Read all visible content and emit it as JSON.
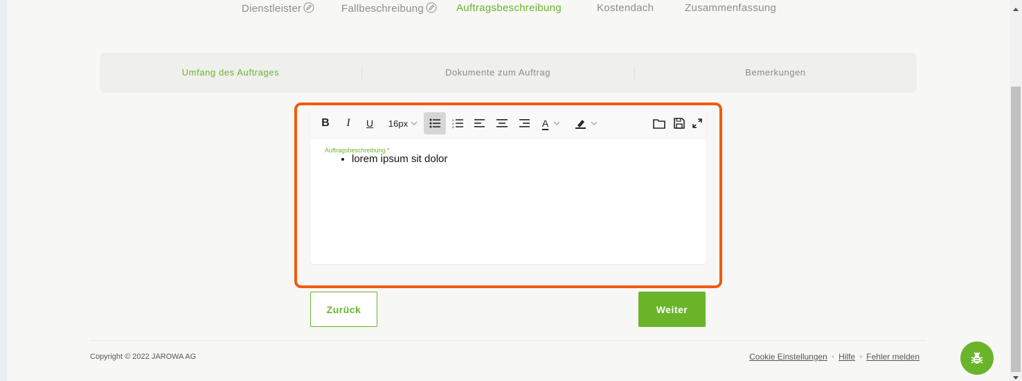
{
  "steps": [
    {
      "label": "Dienstleister",
      "active": false,
      "edit_icon": "pencil-circle-icon"
    },
    {
      "label": "Fallbeschreibung",
      "active": false,
      "edit_icon": "pencil-circle-icon"
    },
    {
      "label": "Auftragsbeschreibung",
      "active": true
    },
    {
      "label": "Kostendach",
      "active": false
    },
    {
      "label": "Zusammenfassung",
      "active": false
    }
  ],
  "tabs": [
    {
      "label": "Umfang des Auftrages",
      "active": true
    },
    {
      "label": "Dokumente zum Auftrag",
      "active": false
    },
    {
      "label": "Bemerkungen",
      "active": false
    }
  ],
  "toolbar": {
    "bold": "B",
    "italic": "I",
    "underline": "U",
    "font_size": "16px",
    "text_color": "A",
    "icons": [
      "bold-icon",
      "italic-icon",
      "underline-icon",
      "bullet-list-icon",
      "numbered-list-icon",
      "align-left-icon",
      "align-center-icon",
      "align-right-icon",
      "text-color-icon",
      "highlight-icon",
      "folder-icon",
      "save-icon",
      "fullscreen-icon"
    ],
    "active": "bullet-list"
  },
  "editor": {
    "label": "Auftragsbeschreibung *",
    "items": [
      "lorem ipsum sit dolor"
    ]
  },
  "buttons": {
    "back": "Zurück",
    "next": "Weiter"
  },
  "footer": {
    "copyright": "Copyright © 2022 JAROWA AG",
    "links": [
      "Cookie Einstellungen",
      "Hilfe",
      "Fehler melden"
    ]
  },
  "colors": {
    "accent": "#6ab42a",
    "highlight": "#f25a0e",
    "text": "#222222",
    "muted": "#8c8c8c"
  }
}
